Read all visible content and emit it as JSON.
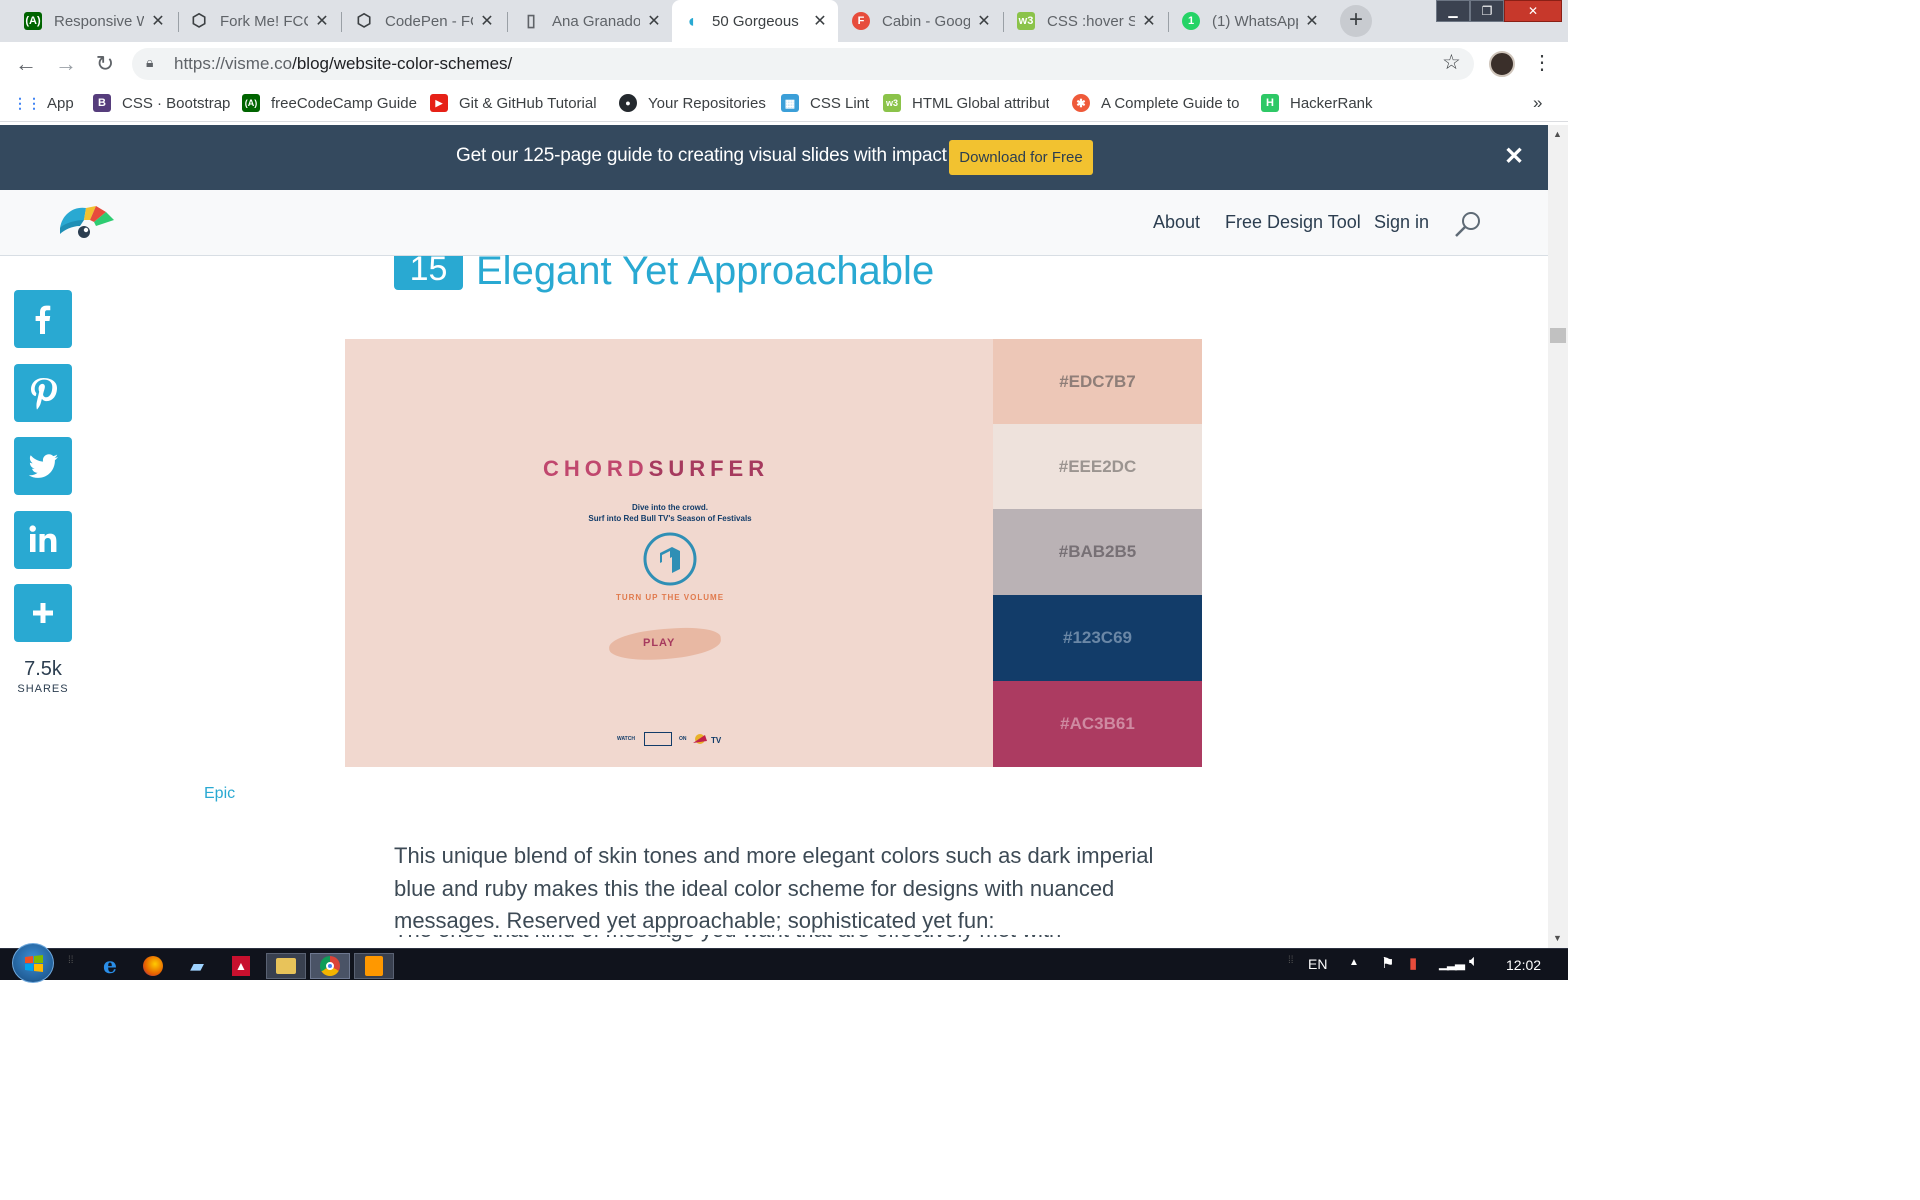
{
  "browser": {
    "tabs": [
      {
        "title": "Responsive Web",
        "favicon": "fcc-icon",
        "color": "#006400",
        "glyph": "(A)"
      },
      {
        "title": "Fork Me! FCC",
        "favicon": "codepen-icon",
        "color": "",
        "glyph": "⬡"
      },
      {
        "title": "CodePen - FCC",
        "favicon": "codepen-icon",
        "color": "",
        "glyph": "⬡"
      },
      {
        "title": "Ana Granado",
        "favicon": "page-icon",
        "color": "",
        "glyph": "▯"
      },
      {
        "title": "50 Gorgeous",
        "favicon": "visme-icon",
        "color": "#29a9d2",
        "glyph": "◖"
      },
      {
        "title": "Cabin - Goog",
        "favicon": "fonts-icon",
        "color": "#e74c3c",
        "glyph": "F"
      },
      {
        "title": "CSS :hover Se",
        "favicon": "w3-icon",
        "color": "#8bc34a",
        "glyph": "w3"
      },
      {
        "title": "(1) WhatsApp",
        "favicon": "whatsapp-icon",
        "color": "#25d366",
        "glyph": "1"
      }
    ],
    "active_tab": 4,
    "url_host": "https://visme.co",
    "url_path": "/blog/website-color-schemes/",
    "bookmarks": [
      {
        "label": "App",
        "icon": "apps-grid-icon",
        "color": "#4285f4",
        "glyph": "⋮⋮"
      },
      {
        "label": "CSS · Bootstrap",
        "icon": "bootstrap-icon",
        "color": "#563d7c",
        "glyph": "B"
      },
      {
        "label": "freeCodeCamp Guide",
        "icon": "fcc-icon",
        "color": "#006400",
        "glyph": "(A)"
      },
      {
        "label": "Git & GitHub Tutorial",
        "icon": "youtube-icon",
        "color": "#e62117",
        "glyph": "▶"
      },
      {
        "label": "Your Repositories",
        "icon": "github-icon",
        "color": "#24292e",
        "glyph": "●"
      },
      {
        "label": "CSS Lint",
        "icon": "csslint-icon",
        "color": "#3b9fd8",
        "glyph": "▦"
      },
      {
        "label": "HTML Global attribut",
        "icon": "w3-icon",
        "color": "#8bc34a",
        "glyph": "w3"
      },
      {
        "label": "A Complete Guide to",
        "icon": "csstricks-icon",
        "color": "#ef5a3a",
        "glyph": "✱"
      },
      {
        "label": "HackerRank",
        "icon": "hackerrank-icon",
        "color": "#2ec866",
        "glyph": "H"
      }
    ],
    "more_glyph": "»"
  },
  "banner": {
    "text": "Get our 125-page guide to creating visual slides with impact",
    "button": "Download for Free"
  },
  "nav": {
    "about": "About",
    "free_design_tool": "Free Design Tool",
    "sign_in": "Sign in"
  },
  "article": {
    "number": "15",
    "heading": "Elegant Yet Approachable",
    "shares": {
      "count": "7.5k",
      "label": "SHARES"
    },
    "image": {
      "brand_left": "CHORD",
      "brand_right": "SURFER",
      "line1": "Dive into the crowd.",
      "line2": "Surf into Red Bull TV's Season of Festivals",
      "volume": "TURN UP THE VOLUME",
      "play": "PLAY",
      "watch": "WATCH",
      "on": "ON",
      "swatches": [
        {
          "hex": "#EDC7B7",
          "color": "#edc7b7",
          "text_color": "#8f7e78"
        },
        {
          "hex": "#EEE2DC",
          "color": "#eee2dc",
          "text_color": "#9b9490"
        },
        {
          "hex": "#BAB2B5",
          "color": "#bab2b5",
          "text_color": "#777075"
        },
        {
          "hex": "#123C69",
          "color": "#123c69",
          "text_color": "#6a87a6"
        },
        {
          "hex": "#AC3B61",
          "color": "#ac3b61",
          "text_color": "#cf8aa1"
        }
      ]
    },
    "caption": "Epic",
    "paragraph": "This unique blend of skin tones and more elegant colors such as dark imperial blue and ruby makes this the ideal color scheme for designs with nuanced messages. Reserved yet approachable; sophisticated yet fun:",
    "paragraph_next": "The ones that kind of message you want that are effectively met with"
  },
  "taskbar": {
    "lang": "EN",
    "time": "12:02"
  },
  "colors": {
    "accent": "#29a9d2",
    "banner_bg": "#34495e",
    "button_yellow": "#f2c230"
  }
}
